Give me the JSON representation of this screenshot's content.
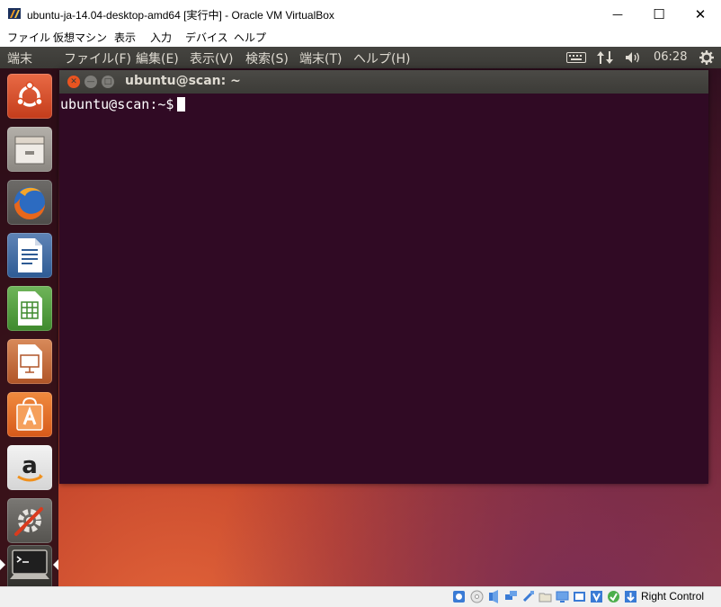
{
  "window": {
    "title": "ubuntu-ja-14.04-desktop-amd64 [実行中] - Oracle VM VirtualBox",
    "controls": {
      "minimize": "—",
      "maximize": "☐",
      "close": "✕"
    }
  },
  "vbox_menu": [
    "ファイル",
    "仮想マシン",
    "表示",
    "入力",
    "デバイス",
    "ヘルプ"
  ],
  "ubuntu_panel": {
    "app_name": "端末",
    "menus": [
      "ファイル(F)",
      "編集(E)",
      "表示(V)",
      "検索(S)",
      "端末(T)",
      "ヘルプ(H)"
    ],
    "clock": "06:28"
  },
  "launcher": [
    {
      "name": "Dash ホーム",
      "icon": "ubuntu-logo-icon"
    },
    {
      "name": "ファイル",
      "icon": "files-icon"
    },
    {
      "name": "Firefox",
      "icon": "firefox-icon"
    },
    {
      "name": "LibreOffice Writer",
      "icon": "writer-icon"
    },
    {
      "name": "LibreOffice Calc",
      "icon": "calc-icon"
    },
    {
      "name": "LibreOffice Impress",
      "icon": "impress-icon"
    },
    {
      "name": "Ubuntu ソフトウェアセンター",
      "icon": "software-center-icon"
    },
    {
      "name": "Amazon",
      "icon": "amazon-icon"
    },
    {
      "name": "システム設定",
      "icon": "system-settings-icon"
    },
    {
      "name": "端末",
      "icon": "terminal-icon"
    }
  ],
  "terminal": {
    "title": "ubuntu@scan: ~",
    "prompt": "ubuntu@scan:~$"
  },
  "statusbar": {
    "host_key": "Right Control"
  },
  "colors": {
    "terminal_bg": "#300a24",
    "panel_bg": "#3c3b37",
    "close_button": "#e95420"
  }
}
